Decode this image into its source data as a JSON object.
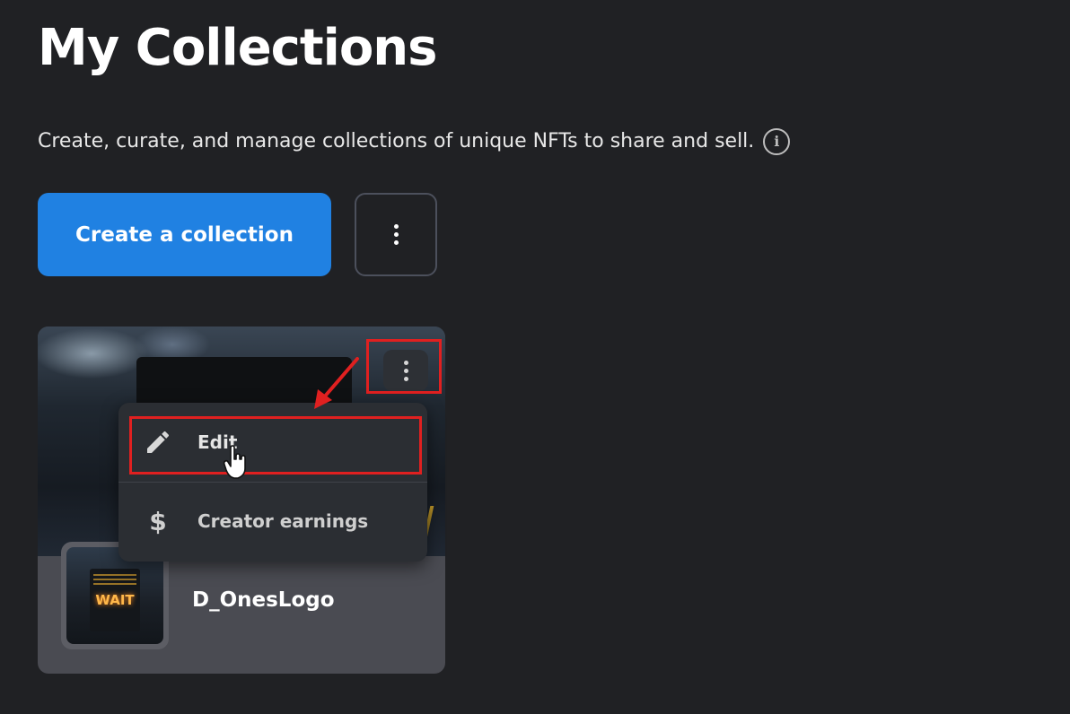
{
  "header": {
    "title": "My Collections",
    "subtitle": "Create, curate, and manage collections of unique NFTs to share and sell."
  },
  "actions": {
    "create_label": "Create a collection"
  },
  "collection_card": {
    "name": "D_OnesLogo",
    "thumbnail_sign_text": "WAIT"
  },
  "context_menu": {
    "items": [
      {
        "label": "Edit",
        "icon": "pencil-icon"
      },
      {
        "label": "Creator earnings",
        "icon": "dollar-icon"
      }
    ]
  },
  "annotations": {
    "highlight_color": "#e02020"
  },
  "colors": {
    "background": "#202124",
    "primary": "#2081e2",
    "menu_bg": "#2b2e33",
    "card_footer": "#4a4b52"
  }
}
